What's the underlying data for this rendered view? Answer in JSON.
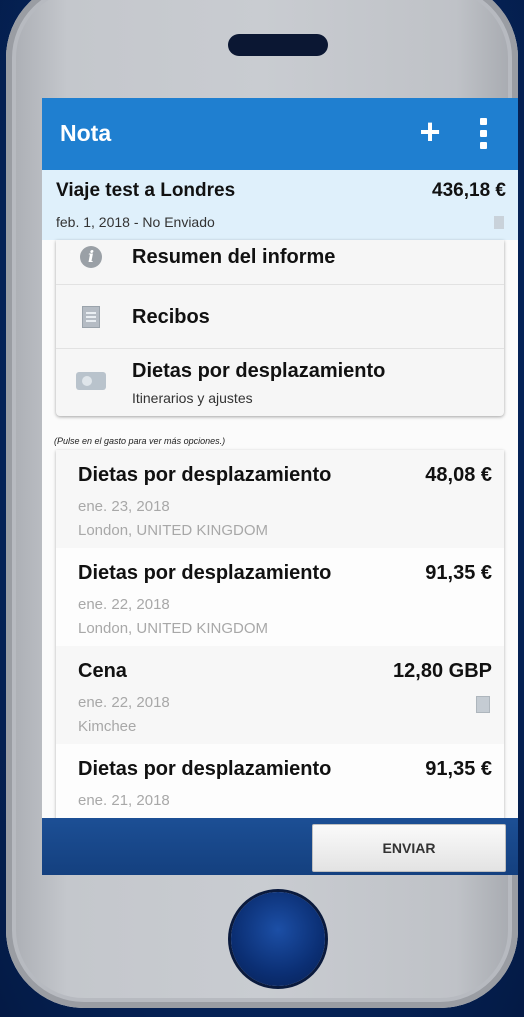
{
  "appbar": {
    "title": "Nota",
    "add_label": "+"
  },
  "report": {
    "name": "Viaje test a Londres",
    "amount": "436,18 €",
    "date": "feb. 1, 2018",
    "separator": "-",
    "status": "No Enviado"
  },
  "menu": {
    "items": [
      {
        "label": "Resumen del informe",
        "icon": "info-icon"
      },
      {
        "label": "Recibos",
        "icon": "receipt-icon"
      },
      {
        "label": "Dietas por desplazamiento",
        "sub": "Itinerarios y ajustes",
        "icon": "ticket-icon"
      }
    ]
  },
  "hint": "(Pulse en el gasto para ver más opciones.)",
  "expenses": [
    {
      "title": "Dietas por desplazamiento",
      "amount": "48,08 €",
      "date": "ene. 23, 2018",
      "location": "London, UNITED KINGDOM"
    },
    {
      "title": "Dietas por desplazamiento",
      "amount": "91,35 €",
      "date": "ene. 22, 2018",
      "location": "London, UNITED KINGDOM"
    },
    {
      "title": "Cena",
      "amount": "12,80 GBP",
      "date": "ene. 22, 2018",
      "location": "Kimchee",
      "has_receipt": true
    },
    {
      "title": "Dietas por desplazamiento",
      "amount": "91,35 €",
      "date": "ene. 21, 2018",
      "location": ""
    }
  ],
  "footer": {
    "send_label": "ENVIAR"
  },
  "colors": {
    "appbar": "#1f7fd0",
    "report_header": "#dff0fb",
    "bottom_bar": "#14407f"
  }
}
